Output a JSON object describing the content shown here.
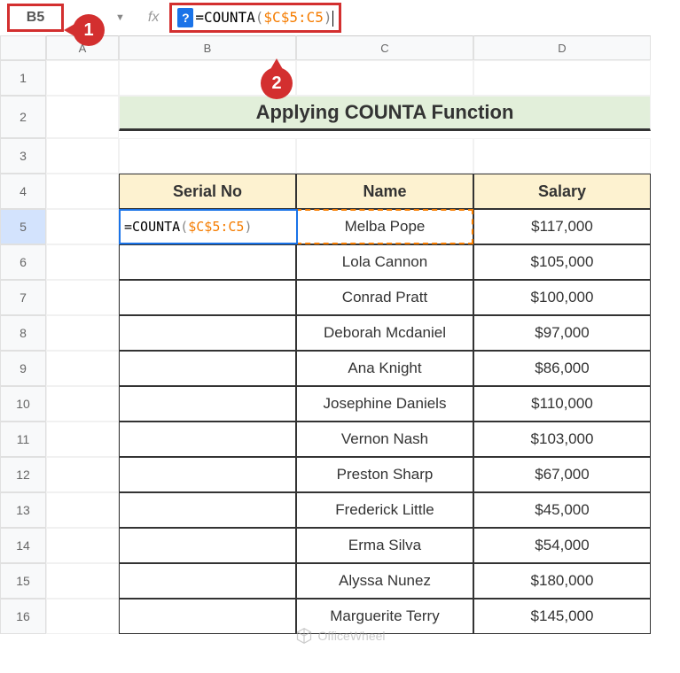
{
  "nameBox": "B5",
  "fxLabel": "fx",
  "helpBadge": "?",
  "formula": {
    "eq": "=",
    "func": "COUNTA",
    "open": "(",
    "ref": "$C$5:C5",
    "close": ")"
  },
  "columns": [
    "A",
    "B",
    "C",
    "D"
  ],
  "rows": [
    "1",
    "2",
    "3",
    "4",
    "5",
    "6",
    "7",
    "8",
    "9",
    "10",
    "11",
    "12",
    "13",
    "14",
    "15",
    "16"
  ],
  "title": "Applying COUNTA Function",
  "headers": {
    "serial": "Serial No",
    "name": "Name",
    "salary": "Salary"
  },
  "cellFormula": {
    "eq": "=",
    "func": "COUNTA",
    "open": "(",
    "ref": "$C$5:C5",
    "close": ")"
  },
  "data": [
    {
      "name": "Melba Pope",
      "salary": "$117,000"
    },
    {
      "name": "Lola Cannon",
      "salary": "$105,000"
    },
    {
      "name": "Conrad Pratt",
      "salary": "$100,000"
    },
    {
      "name": "Deborah Mcdaniel",
      "salary": "$97,000"
    },
    {
      "name": "Ana Knight",
      "salary": "$86,000"
    },
    {
      "name": "Josephine Daniels",
      "salary": "$110,000"
    },
    {
      "name": "Vernon Nash",
      "salary": "$103,000"
    },
    {
      "name": "Preston Sharp",
      "salary": "$67,000"
    },
    {
      "name": "Frederick Little",
      "salary": "$45,000"
    },
    {
      "name": "Erma Silva",
      "salary": "$54,000"
    },
    {
      "name": "Alyssa Nunez",
      "salary": "$180,000"
    },
    {
      "name": "Marguerite Terry",
      "salary": "$145,000"
    }
  ],
  "callouts": {
    "one": "1",
    "two": "2"
  },
  "watermark": "OfficeWheel"
}
